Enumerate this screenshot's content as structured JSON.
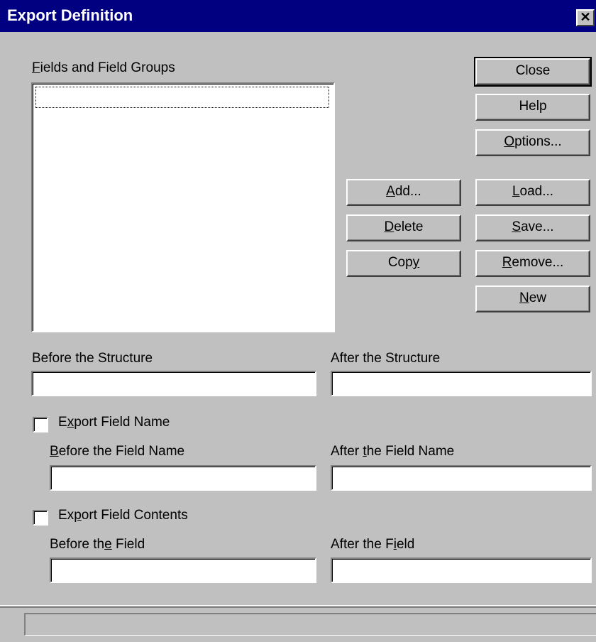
{
  "window": {
    "title": "Export Definition",
    "close_glyph": "✕"
  },
  "list": {
    "label": "Fields and Field Groups",
    "label_accel": "F",
    "label_rest": "ields and Field Groups",
    "items": []
  },
  "buttons": {
    "close": "Close",
    "help": "Help",
    "options": {
      "accel": "O",
      "rest": "ptions..."
    },
    "add": {
      "accel": "A",
      "rest": "dd..."
    },
    "delete": {
      "accel": "D",
      "rest": "elete"
    },
    "copy": {
      "pre": "Cop",
      "accel": "y",
      "rest": ""
    },
    "load": {
      "accel": "L",
      "rest": "oad..."
    },
    "save": {
      "accel": "S",
      "rest": "ave..."
    },
    "remove": {
      "accel": "R",
      "rest": "emove..."
    },
    "new": {
      "accel": "N",
      "rest": "ew"
    }
  },
  "structure": {
    "before_label": "Before the Structure",
    "before_value": "",
    "after_label": "After the Structure",
    "after_value": ""
  },
  "field_name": {
    "checkbox_pre": "E",
    "checkbox_accel": "x",
    "checkbox_rest": "port Field Name",
    "checked": false,
    "before_accel": "B",
    "before_rest": "efore the Field Name",
    "before_value": "",
    "after_pre": "After ",
    "after_accel": "t",
    "after_rest": "he Field Name",
    "after_value": ""
  },
  "field_contents": {
    "checkbox_pre": "Ex",
    "checkbox_accel": "p",
    "checkbox_rest": "ort Field Contents",
    "checked": false,
    "before_pre": "Before th",
    "before_accel": "e",
    "before_rest": " Field",
    "before_value": "",
    "after_pre": "After the F",
    "after_accel": "i",
    "after_rest": "eld",
    "after_value": ""
  },
  "status": {
    "text": ""
  }
}
